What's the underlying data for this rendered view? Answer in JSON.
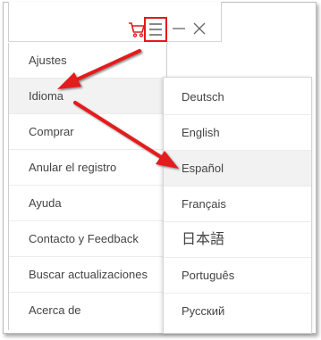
{
  "titlebar": {
    "icons": [
      "cart-icon",
      "menu-icon",
      "minimize-icon",
      "close-icon"
    ]
  },
  "menu": {
    "items": [
      {
        "label": "Ajustes"
      },
      {
        "label": "Idioma"
      },
      {
        "label": "Comprar"
      },
      {
        "label": "Anular el registro"
      },
      {
        "label": "Ayuda"
      },
      {
        "label": "Contacto y Feedback"
      },
      {
        "label": "Buscar actualizaciones"
      },
      {
        "label": "Acerca de"
      }
    ]
  },
  "language_menu": {
    "items": [
      {
        "label": "Deutsch"
      },
      {
        "label": "English"
      },
      {
        "label": "Español"
      },
      {
        "label": "Français"
      },
      {
        "label": "日本語"
      },
      {
        "label": "Português"
      },
      {
        "label": "Русский"
      }
    ],
    "selected": "Español"
  },
  "colors": {
    "accent_red": "#e31a1a",
    "menu_text": "#444444",
    "hover_bg": "#f2f2f2"
  }
}
